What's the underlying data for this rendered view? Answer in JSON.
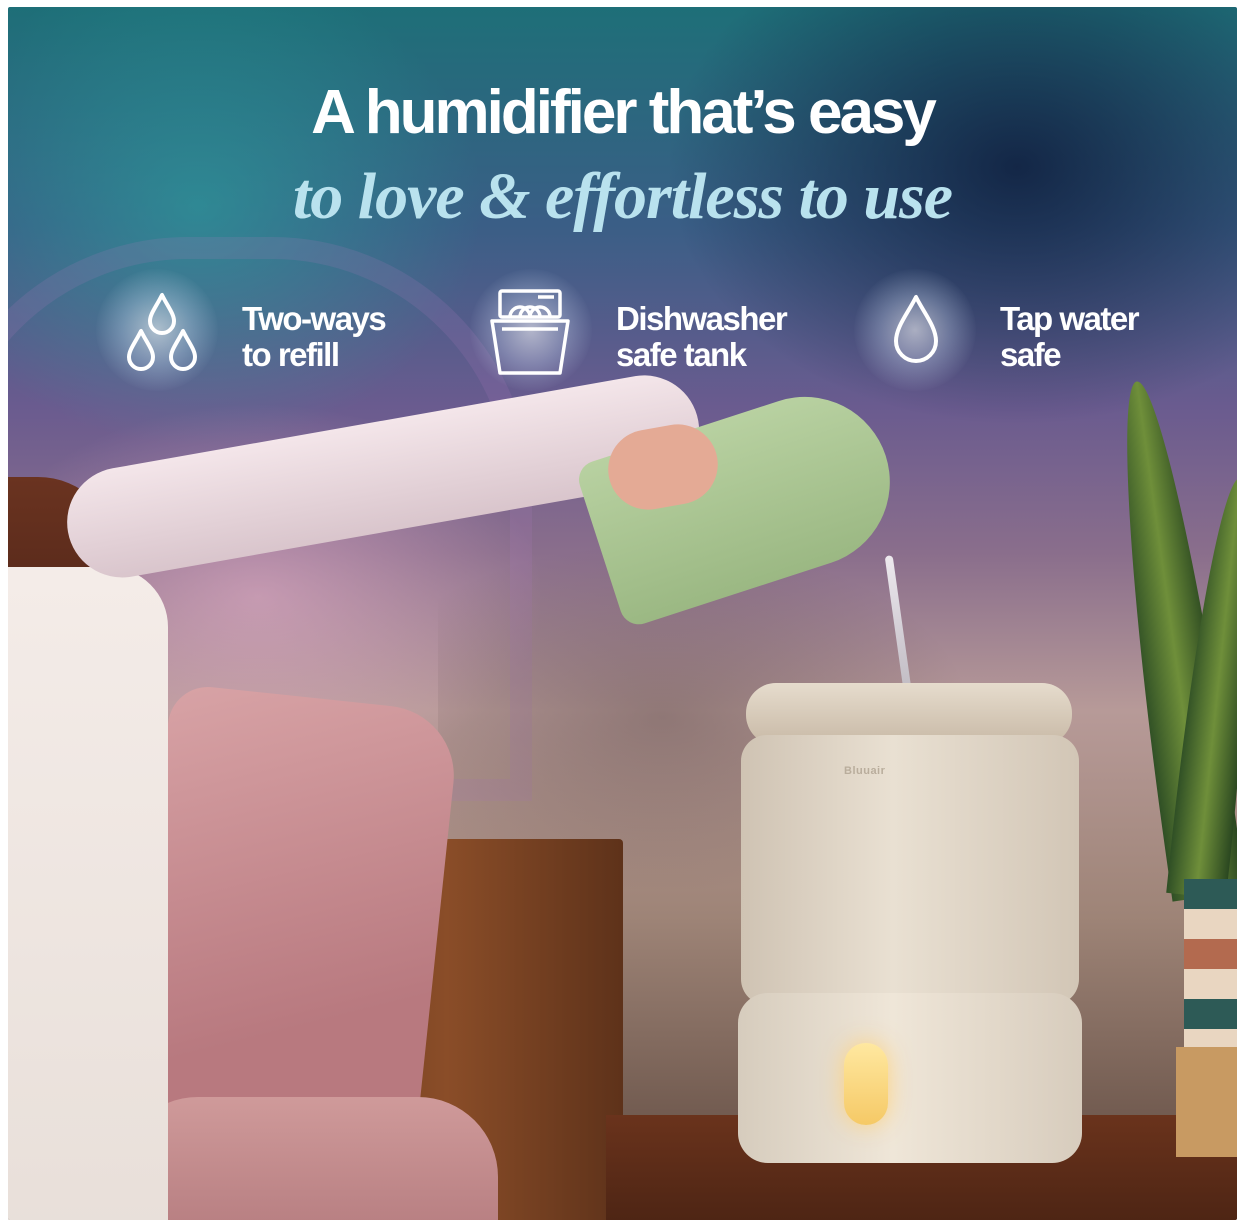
{
  "headline": "A humidifier that’s easy",
  "subline": "to love & effortless to use",
  "features": [
    {
      "icon": "water-drops-icon",
      "line1": "Two-ways",
      "line2": "to refill"
    },
    {
      "icon": "dishwasher-icon",
      "line1": "Dishwasher",
      "line2": "safe tank"
    },
    {
      "icon": "water-drop-icon",
      "line1": "Tap water",
      "line2": "safe"
    }
  ],
  "product": {
    "logo": "Bluuair"
  },
  "colors": {
    "headline": "#ffffff",
    "subline": "#b9e2ee",
    "accent_teal": "#1e6f78",
    "night_navy": "#14233f",
    "humidifier": "#e9e0d2"
  }
}
